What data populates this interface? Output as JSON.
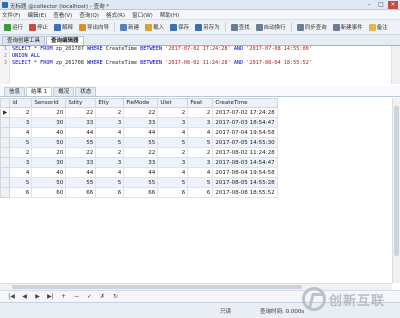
{
  "window": {
    "title": "无标题 @collector (localhost) - 查询 *",
    "minimize": "–",
    "maximize": "□",
    "close": "×"
  },
  "menu": [
    "文件(F)",
    "编辑(E)",
    "查看(V)",
    "查询(Q)",
    "格式(R)",
    "窗口(W)",
    "帮助(H)"
  ],
  "toolbar": [
    {
      "label": "运行",
      "color": "#3a9a3a"
    },
    {
      "label": "停止",
      "color": "#c94a3e"
    },
    {
      "label": "解释",
      "color": "#3c6fb4"
    },
    {
      "label": "导出向导",
      "color": "#d9902a"
    },
    {
      "label": "新建",
      "color": "#5b7fbf"
    },
    {
      "label": "载入",
      "color": "#d7a431"
    },
    {
      "label": "保存",
      "color": "#3c6fb4"
    },
    {
      "label": "另存为",
      "color": "#3c6fb4"
    },
    {
      "label": "查找",
      "color": "#6b7c93"
    },
    {
      "label": "自动换行",
      "color": "#6b7c93"
    },
    {
      "label": "同步查询",
      "color": "#6b7c93"
    },
    {
      "label": "新建事件",
      "color": "#6b7c93"
    },
    {
      "label": "备注",
      "color": "#e0b84a"
    }
  ],
  "doc_tabs": [
    "查询创建工具",
    "查询编辑器"
  ],
  "editor": {
    "line_numbers": [
      "1",
      "2",
      "3"
    ],
    "lines": [
      [
        {
          "t": "SELECT",
          "c": "kw"
        },
        {
          "t": " * ",
          "c": "tbl"
        },
        {
          "t": "FROM",
          "c": "kw"
        },
        {
          "t": " zp_201707 ",
          "c": "tbl"
        },
        {
          "t": "WHERE",
          "c": "kw"
        },
        {
          "t": " CreateTime ",
          "c": "tbl"
        },
        {
          "t": "BETWEEN",
          "c": "kw"
        },
        {
          "t": " '2017-07-02 17:24:28' ",
          "c": "str"
        },
        {
          "t": "AND",
          "c": "kw"
        },
        {
          "t": " '2017-07-08 14:55:00'",
          "c": "str"
        }
      ],
      [
        {
          "t": "UNION ALL",
          "c": "kw"
        }
      ],
      [
        {
          "t": "SELECT",
          "c": "kw"
        },
        {
          "t": " * ",
          "c": "tbl"
        },
        {
          "t": "FROM",
          "c": "kw"
        },
        {
          "t": " zp_201708 ",
          "c": "tbl"
        },
        {
          "t": "WHERE",
          "c": "kw"
        },
        {
          "t": " CreateTime ",
          "c": "tbl"
        },
        {
          "t": "BETWEEN",
          "c": "kw"
        },
        {
          "t": " '2017-08-02 11:24:28' ",
          "c": "str"
        },
        {
          "t": "AND",
          "c": "kw"
        },
        {
          "t": " '2017-08-04 18:55:52'",
          "c": "str"
        }
      ]
    ]
  },
  "result_tabs": [
    "信息",
    "结果 1",
    "概况",
    "状态"
  ],
  "grid": {
    "columns": [
      "id",
      "SensorId",
      "Sdity",
      "Elty",
      "FieMode",
      "Ulet",
      "Feat",
      "CreateTime"
    ],
    "rows": [
      [
        "2",
        "20",
        "22",
        "2",
        "22",
        "2",
        "2",
        "2017-07-02 17:24:28"
      ],
      [
        "3",
        "30",
        "33",
        "3",
        "33",
        "3",
        "3",
        "2017-07-03 18:54:47"
      ],
      [
        "4",
        "40",
        "44",
        "4",
        "44",
        "4",
        "4",
        "2017-07-04 19:54:58"
      ],
      [
        "5",
        "50",
        "55",
        "5",
        "55",
        "5",
        "5",
        "2017-07-05 14:55:30"
      ],
      [
        "2",
        "20",
        "22",
        "2",
        "22",
        "2",
        "2",
        "2017-08-02 11:24:28"
      ],
      [
        "3",
        "30",
        "33",
        "3",
        "33",
        "3",
        "3",
        "2017-08-03 14:54:47"
      ],
      [
        "4",
        "40",
        "44",
        "4",
        "44",
        "4",
        "4",
        "2017-08-04 19:54:58"
      ],
      [
        "5",
        "50",
        "55",
        "5",
        "55",
        "5",
        "5",
        "2017-08-05 14:55:28"
      ],
      [
        "6",
        "60",
        "66",
        "6",
        "66",
        "6",
        "6",
        "2017-08-08 18:55:52"
      ]
    ],
    "selected_row_marker": "▶"
  },
  "nav": [
    "|◀",
    "◀",
    "▶",
    "▶|",
    "+",
    "−",
    "✓",
    "✗",
    "↻"
  ],
  "status": {
    "readonly": "只读",
    "query_time": "查询时间: 0.000s"
  },
  "watermark": {
    "text": "创新互联"
  }
}
